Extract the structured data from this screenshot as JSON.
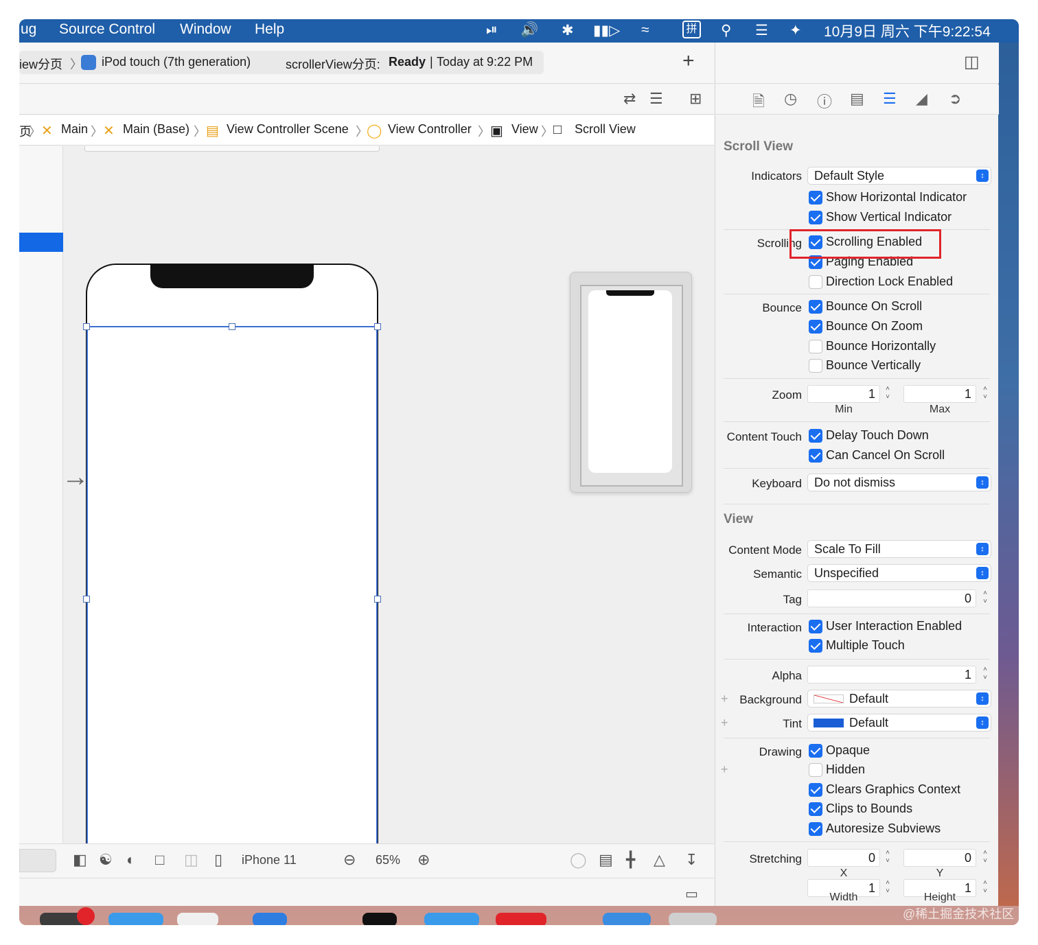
{
  "menubar": {
    "items": [
      "ug",
      "Source Control",
      "Window",
      "Help"
    ],
    "ime_label": "拼",
    "clock": "10月9日 周六 下午9:22:54",
    "icons": [
      "play-icon",
      "volume-icon",
      "bluetooth-icon",
      "battery-icon",
      "wifi-icon",
      "input-method-icon",
      "search-icon",
      "control-center-icon",
      "siri-icon"
    ]
  },
  "toolbar": {
    "scheme": "iew分页",
    "device": "iPod touch (7th generation)",
    "status_project": "scrollerView分页:",
    "status_state": "Ready",
    "status_sep": "|",
    "status_time": "Today at 9:22 PM",
    "add_label": "+"
  },
  "jumpbar": {
    "items": [
      "页",
      "Main",
      "Main (Base)",
      "View Controller Scene",
      "View Controller",
      "View",
      "Scroll View"
    ]
  },
  "bottombar": {
    "device_label": "iPhone 11",
    "zoom": "65%"
  },
  "inspector": {
    "scroll_view_title": "Scroll View",
    "indicators": {
      "label": "Indicators",
      "value": "Default Style",
      "options": [
        {
          "label": "Show Horizontal Indicator",
          "checked": true
        },
        {
          "label": "Show Vertical Indicator",
          "checked": true
        }
      ]
    },
    "scrolling": {
      "label": "Scrolling",
      "options": [
        {
          "label": "Scrolling Enabled",
          "checked": true
        },
        {
          "label": "Paging Enabled",
          "checked": true
        },
        {
          "label": "Direction Lock Enabled",
          "checked": false
        }
      ]
    },
    "bounce": {
      "label": "Bounce",
      "options": [
        {
          "label": "Bounce On Scroll",
          "checked": true
        },
        {
          "label": "Bounce On Zoom",
          "checked": true
        },
        {
          "label": "Bounce Horizontally",
          "checked": false
        },
        {
          "label": "Bounce Vertically",
          "checked": false
        }
      ]
    },
    "zoom": {
      "label": "Zoom",
      "min": "1",
      "max": "1",
      "min_label": "Min",
      "max_label": "Max"
    },
    "content_touch": {
      "label": "Content Touch",
      "options": [
        {
          "label": "Delay Touch Down",
          "checked": true
        },
        {
          "label": "Can Cancel On Scroll",
          "checked": true
        }
      ]
    },
    "keyboard": {
      "label": "Keyboard",
      "value": "Do not dismiss"
    },
    "view_title": "View",
    "content_mode": {
      "label": "Content Mode",
      "value": "Scale To Fill"
    },
    "semantic": {
      "label": "Semantic",
      "value": "Unspecified"
    },
    "tag": {
      "label": "Tag",
      "value": "0"
    },
    "interaction": {
      "label": "Interaction",
      "options": [
        {
          "label": "User Interaction Enabled",
          "checked": true
        },
        {
          "label": "Multiple Touch",
          "checked": true
        }
      ]
    },
    "alpha": {
      "label": "Alpha",
      "value": "1"
    },
    "background": {
      "label": "Background",
      "value": "Default"
    },
    "tint": {
      "label": "Tint",
      "value": "Default",
      "color": "#1a5ed6"
    },
    "drawing": {
      "label": "Drawing",
      "options": [
        {
          "label": "Opaque",
          "checked": true
        },
        {
          "label": "Hidden",
          "checked": false
        },
        {
          "label": "Clears Graphics Context",
          "checked": true
        },
        {
          "label": "Clips to Bounds",
          "checked": true
        },
        {
          "label": "Autoresize Subviews",
          "checked": true
        }
      ]
    },
    "stretching": {
      "label": "Stretching",
      "x": "0",
      "y": "0",
      "width": "1",
      "height": "1",
      "x_label": "X",
      "y_label": "Y",
      "width_label": "Width",
      "height_label": "Height"
    }
  },
  "highlight_color": "#e0242a",
  "accent_color": "#1a6ef0",
  "watermark": "@稀土掘金技术社区"
}
